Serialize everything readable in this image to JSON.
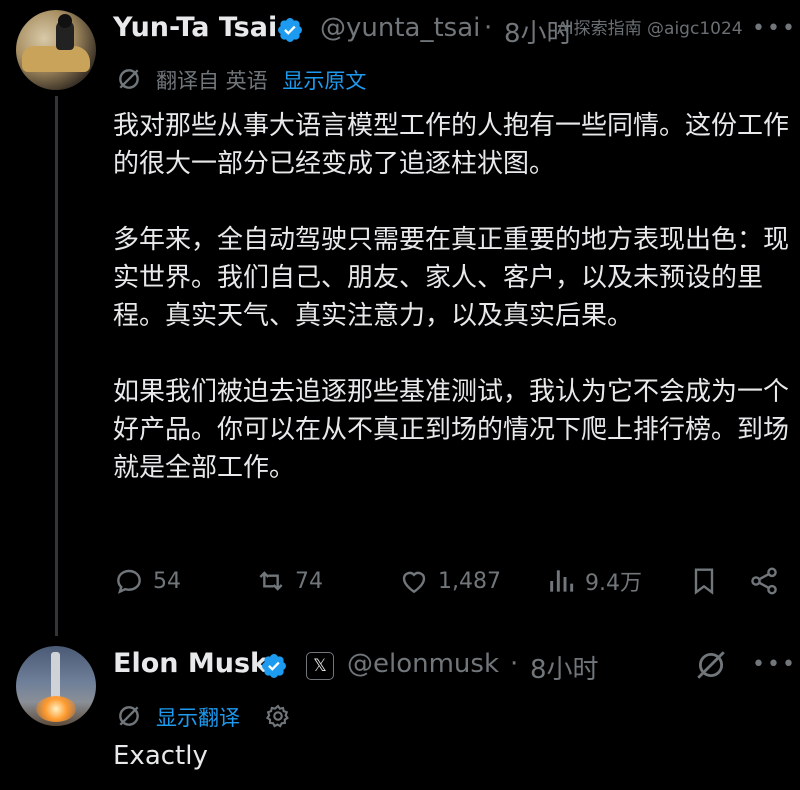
{
  "watermark": "AI探索指南 @aigc1024",
  "tweet1": {
    "name": "Yun-Ta Tsai",
    "handle": "@yunta_tsai",
    "sep": "·",
    "time": "8小时",
    "translated_from": "翻译自 英语",
    "show_original": "显示原文",
    "body": "我对那些从事大语言模型工作的人抱有一些同情。这份工作的很大一部分已经变成了追逐柱状图。\n\n多年来，全自动驾驶只需要在真正重要的地方表现出色：现实世界。我们自己、朋友、家人、客户，以及未预设的里程。真实天气、真实注意力，以及真实后果。\n\n如果我们被迫去追逐那些基准测试，我认为它不会成为一个好产品。你可以在从不真正到场的情况下爬上排行榜。到场就是全部工作。",
    "actions": {
      "replies": "54",
      "reposts": "74",
      "likes": "1,487",
      "views": "9.4万"
    }
  },
  "tweet2": {
    "name": "Elon Musk",
    "x_badge": "𝕏",
    "handle": "@elonmusk",
    "sep": "·",
    "time": "8小时",
    "show_translation": "显示翻译",
    "body": "Exactly"
  },
  "colors": {
    "background": "#000000",
    "text": "#e7e9ea",
    "muted": "#71767b",
    "accent": "#1d9bf0"
  },
  "icons": [
    "verified-badge-icon",
    "translate-icon",
    "reply-icon",
    "repost-icon",
    "like-icon",
    "views-icon",
    "bookmark-icon",
    "share-icon",
    "grok-icon",
    "more-icon",
    "settings-icon"
  ]
}
